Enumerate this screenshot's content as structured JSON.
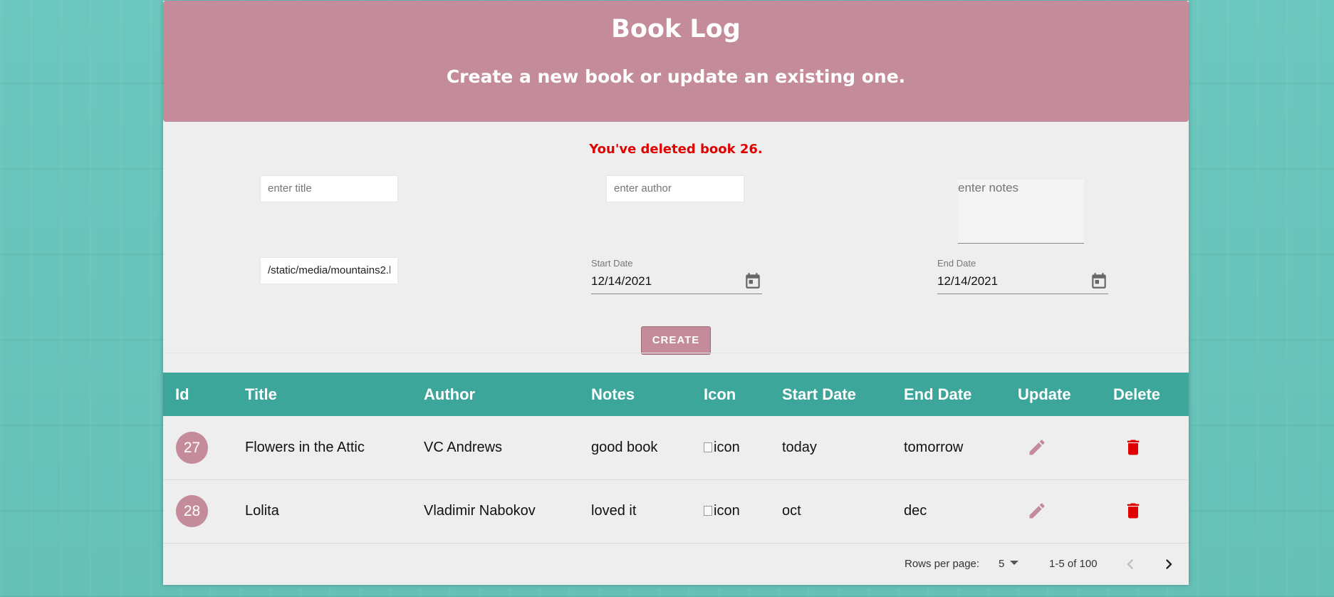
{
  "header": {
    "title": "Book Log",
    "subtitle": "Create a new book or update an existing one."
  },
  "message": "You've deleted book 26.",
  "form": {
    "title_placeholder": "enter title",
    "author_placeholder": "enter author",
    "notes_placeholder": "enter notes",
    "icon_value": "/static/media/mountains2.b",
    "start_date_label": "Start Date",
    "start_date_value": "12/14/2021",
    "end_date_label": "End Date",
    "end_date_value": "12/14/2021",
    "create_label": "CREATE"
  },
  "table": {
    "columns": [
      "Id",
      "Title",
      "Author",
      "Notes",
      "Icon",
      "Start Date",
      "End Date",
      "Update",
      "Delete"
    ],
    "rows": [
      {
        "id": "27",
        "title": "Flowers in the Attic",
        "author": "VC Andrews",
        "notes": "good book",
        "icon_alt": "icon",
        "start": "today",
        "end": "tomorrow"
      },
      {
        "id": "28",
        "title": "Lolita",
        "author": "Vladimir Nabokov",
        "notes": "loved it",
        "icon_alt": "icon",
        "start": "oct",
        "end": "dec"
      }
    ]
  },
  "pagination": {
    "rows_per_page_label": "Rows per page:",
    "rows_per_page_value": "5",
    "range_text": "1-5 of 100"
  },
  "colors": {
    "accent": "#c48c9a",
    "table_header": "#3da69a",
    "delete": "#e00000",
    "message": "#e00000"
  },
  "icons": {
    "calendar": "calendar-icon",
    "edit": "pencil-icon",
    "delete": "trash-icon",
    "prev": "chevron-left-icon",
    "next": "chevron-right-icon",
    "dropdown": "caret-down-icon"
  }
}
